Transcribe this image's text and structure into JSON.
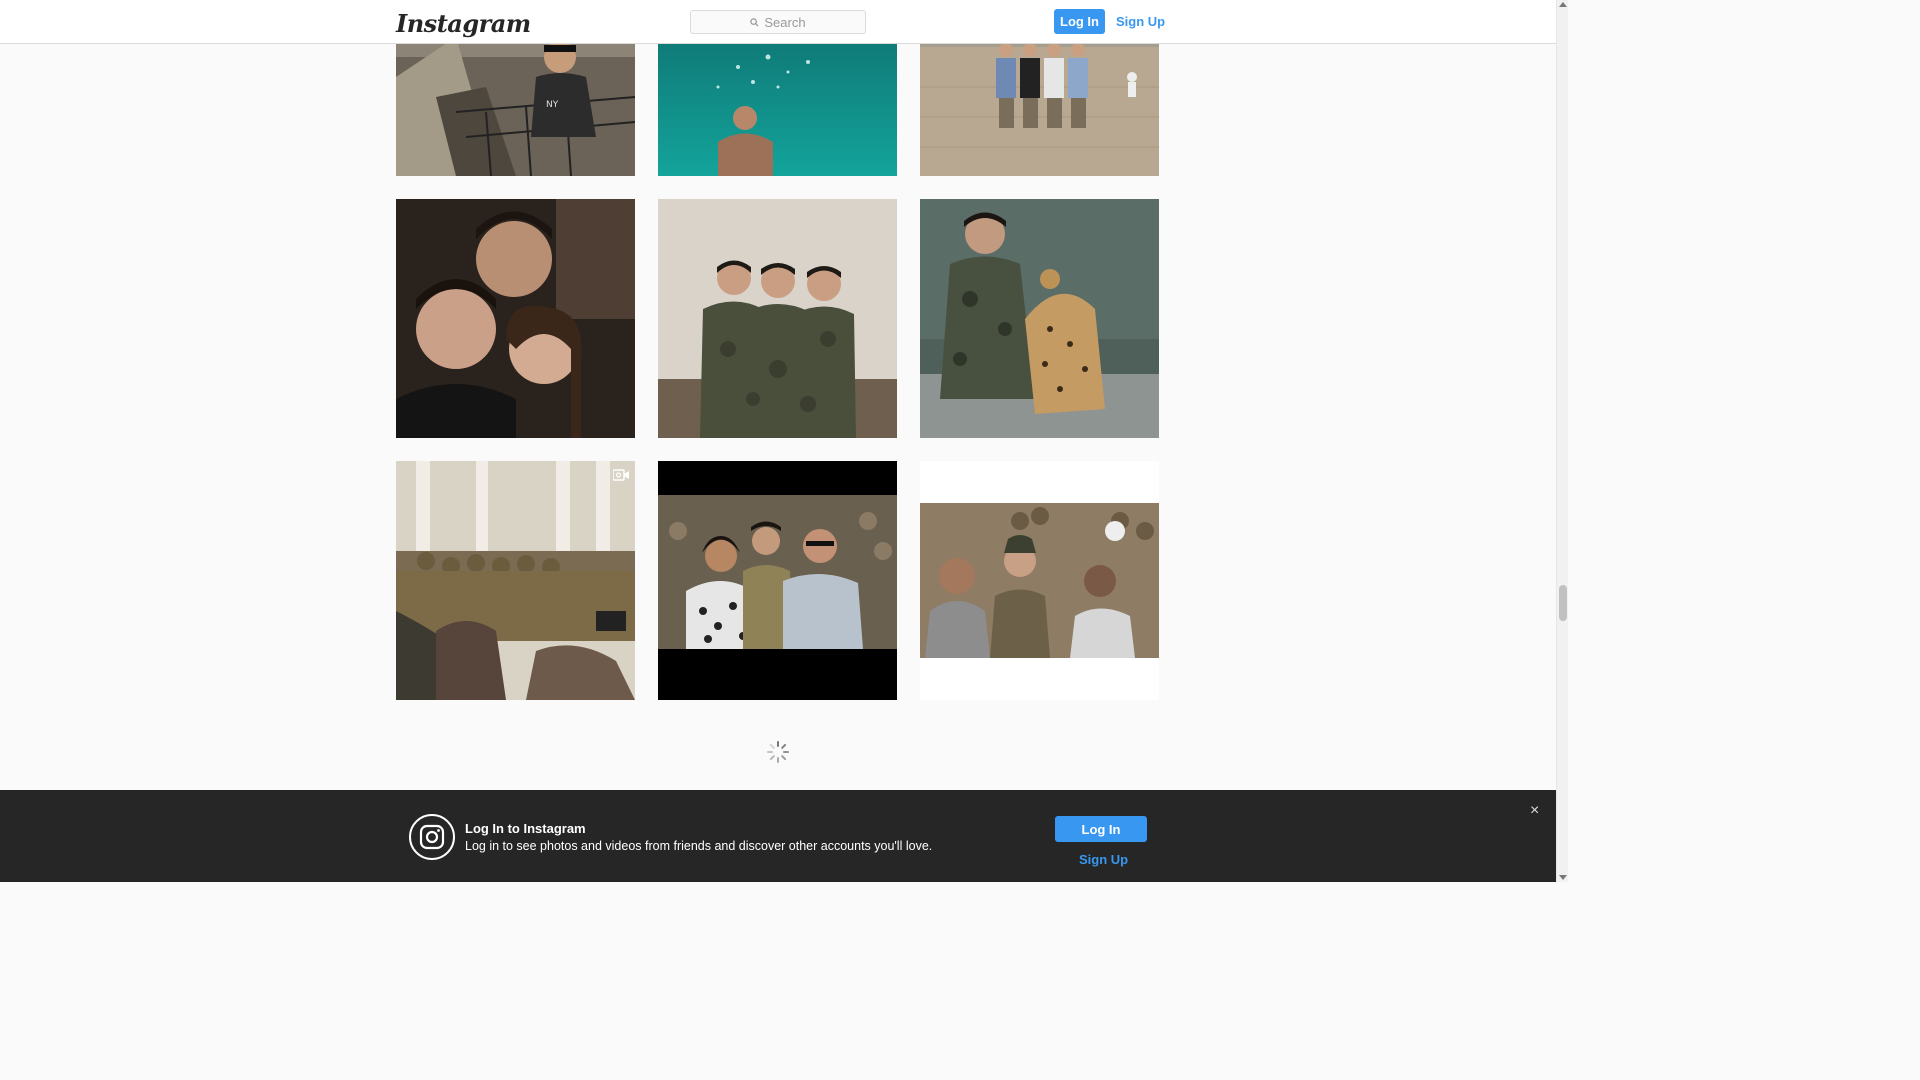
{
  "header": {
    "logo": "Instagram",
    "search_placeholder": "Search",
    "login_label": "Log In",
    "signup_label": "Sign Up"
  },
  "grid": {
    "posts": [
      {
        "type": "photo"
      },
      {
        "type": "photo"
      },
      {
        "type": "photo"
      },
      {
        "type": "photo"
      },
      {
        "type": "photo"
      },
      {
        "type": "photo"
      },
      {
        "type": "video"
      },
      {
        "type": "photo"
      },
      {
        "type": "photo"
      }
    ]
  },
  "banner": {
    "title": "Log In to Instagram",
    "text": "Log in to see photos and videos from friends and discover other accounts you'll love.",
    "login_label": "Log In",
    "signup_label": "Sign Up",
    "close_label": "×"
  },
  "colors": {
    "accent": "#3897f0",
    "banner_bg": "#262626",
    "nav_bg": "#ffffff"
  }
}
